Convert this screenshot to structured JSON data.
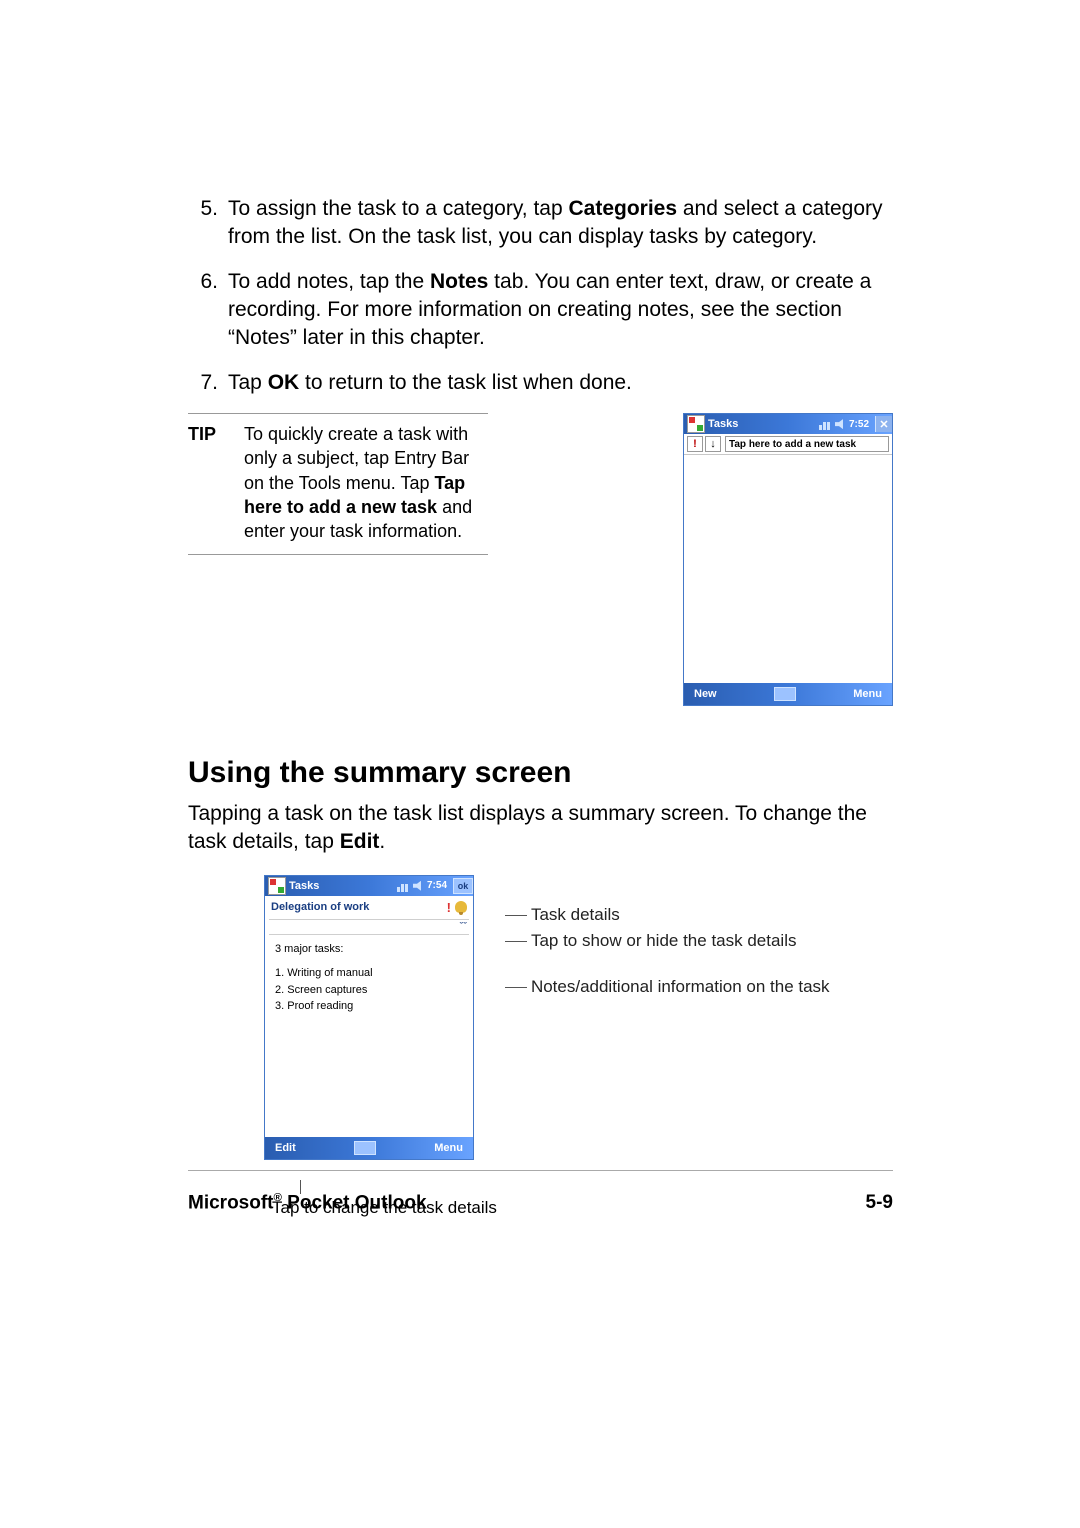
{
  "steps": {
    "n5": "5.",
    "s5_a": "To assign the task to a category, tap ",
    "s5_b": "Categories",
    "s5_c": " and select a category from the list. On the task list, you can display tasks by category.",
    "n6": "6.",
    "s6_a": "To add notes, tap the ",
    "s6_b": "Notes",
    "s6_c": " tab. You can enter text, draw, or create a recording. For more information on creating notes, see the section “Notes” later in this chapter.",
    "n7": "7.",
    "s7_a": "Tap ",
    "s7_b": "OK",
    "s7_c": " to return to the task list when done."
  },
  "tip": {
    "label": "TIP",
    "t1": "To quickly create a task with only a subject, tap Entry Bar on the Tools menu. Tap ",
    "t2": "Tap here to add a new task",
    "t3": " and enter your task information."
  },
  "dev1": {
    "title": "Tasks",
    "time": "7:52",
    "close": "✕",
    "pri": "!",
    "sort": "↓",
    "add": "Tap here to add a new task",
    "new": "New",
    "menu": "Menu"
  },
  "section_heading": "Using the summary screen",
  "section_body_a": "Tapping a task on the task list displays a summary screen. To change the task details, tap ",
  "section_body_b": "Edit",
  "section_body_c": ".",
  "dev2": {
    "title": "Tasks",
    "time": "7:54",
    "ok": "ok",
    "subject": "Delegation of work",
    "pri": "!",
    "chev": "ˇˇ",
    "notes_h": "3 major tasks:",
    "note1": "1. Writing of manual",
    "note2": "2. Screen captures",
    "note3": "3. Proof reading",
    "edit": "Edit",
    "menu": "Menu"
  },
  "callouts": {
    "c1": "Task details",
    "c2": "Tap to show or hide the task details",
    "c3": "Notes/additional information on the task",
    "c4": "Tap to change the task details"
  },
  "footer": {
    "title_a": "Microsoft",
    "title_b": " Pocket Outlook",
    "reg": "®",
    "page": "5-9"
  }
}
